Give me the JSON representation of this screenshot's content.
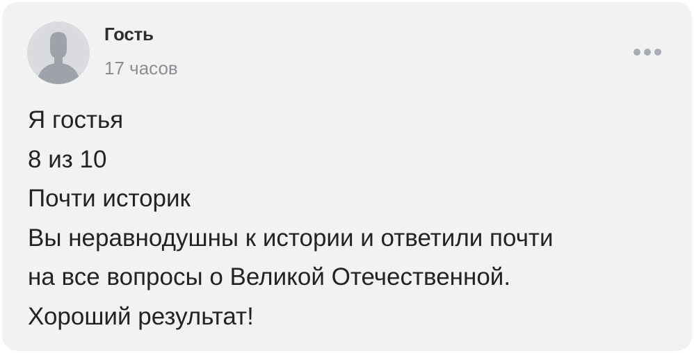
{
  "comment": {
    "author": {
      "name": "Гость",
      "avatar_icon": "user-silhouette-icon"
    },
    "time": "17 часов",
    "more_icon": "more-horizontal-icon",
    "body_lines": [
      "Я гостья",
      "8 из 10",
      "Почти историк",
      "Вы неравнодушны к истории и ответили почти",
      "на все вопросы о Великой Отечественной.",
      "Хороший результат!"
    ]
  },
  "colors": {
    "card_background": "#f2f2f2",
    "author_text": "#2c2d2e",
    "secondary_text": "#8a8d92",
    "body_text": "#222324",
    "avatar_background": "#d9dbde",
    "avatar_silhouette": "#9ea3aa",
    "more_dots": "#a9adb3"
  }
}
